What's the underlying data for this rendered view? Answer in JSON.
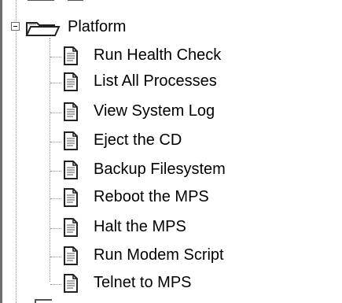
{
  "tree": {
    "root": {
      "label": "Platform",
      "expanded": true,
      "icon": "folder-open-icon"
    },
    "children": [
      {
        "label": "Run Health Check",
        "icon": "document-icon"
      },
      {
        "label": "List All Processes",
        "icon": "document-icon"
      },
      {
        "label": "View System Log",
        "icon": "document-icon"
      },
      {
        "label": "Eject the CD",
        "icon": "document-icon"
      },
      {
        "label": "Backup Filesystem",
        "icon": "document-icon"
      },
      {
        "label": "Reboot the MPS",
        "icon": "document-icon"
      },
      {
        "label": "Halt the MPS",
        "icon": "document-icon"
      },
      {
        "label": "Run Modem Script",
        "icon": "document-icon"
      },
      {
        "label": "Telnet to MPS",
        "icon": "document-icon"
      }
    ]
  }
}
